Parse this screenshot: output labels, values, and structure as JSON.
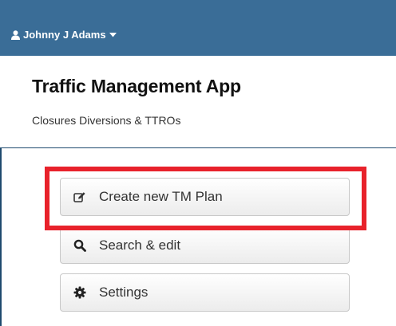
{
  "navbar": {
    "user_name": "Johnny J Adams",
    "user_icon": "user-icon",
    "caret_icon": "caret-down-icon",
    "background_color": "#3a6d97"
  },
  "header": {
    "title": "Traffic Management App",
    "subtitle": "Closures Diversions & TTROs"
  },
  "actions": {
    "create": {
      "label": "Create new TM Plan",
      "icon": "edit-icon"
    },
    "search": {
      "label": "Search & edit",
      "icon": "search-icon"
    },
    "settings": {
      "label": "Settings",
      "icon": "gear-icon"
    }
  },
  "highlight": {
    "color": "#e8222b",
    "target": "create"
  }
}
